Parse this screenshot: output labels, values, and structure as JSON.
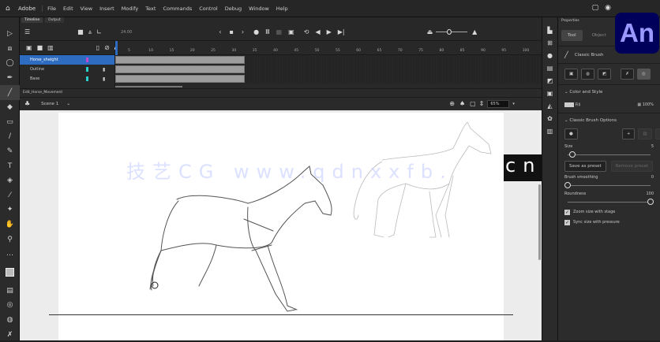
{
  "app": {
    "brand": "Adobe",
    "logo_text": "An",
    "menu": [
      "File",
      "Edit",
      "View",
      "Insert",
      "Modify",
      "Text",
      "Commands",
      "Control",
      "Debug",
      "Window",
      "Help"
    ]
  },
  "timeline": {
    "tabs": [
      "Timeline",
      "Output"
    ],
    "fps": "24.00",
    "frame_ticks": [
      "5",
      "10",
      "15",
      "20",
      "25",
      "30",
      "35",
      "40",
      "45",
      "50",
      "55",
      "60",
      "65",
      "70",
      "75",
      "80",
      "85",
      "90",
      "95",
      "100"
    ],
    "layers": [
      {
        "name": "Horse_sheight",
        "color": "#c04ad0",
        "selected": true
      },
      {
        "name": "Outline",
        "color": "#2ad0d0"
      },
      {
        "name": "Base",
        "color": "#2ad0d0"
      }
    ]
  },
  "editbar": {
    "doc_tab": "Edit_Horse_Movement",
    "scene": "Scene 1",
    "zoom": "65%"
  },
  "watermark": {
    "text": "技艺CG www.qdnxxfb.",
    "suffix": "cn"
  },
  "properties": {
    "title": "Properties",
    "tabs": [
      "Tool",
      "Object"
    ],
    "tool_name": "Classic Brush",
    "color_style": {
      "label": "Color and Style",
      "fill_label": "Fill",
      "opacity": "100%"
    },
    "brush_options": {
      "label": "Classic Brush Options",
      "size_label": "Size",
      "size": "5",
      "size_pct": 5,
      "save_preset": "Save as preset",
      "remove_preset": "Remove preset",
      "smoothing_label": "Brush smoothing",
      "smoothing": "0",
      "smoothing_pct": 0,
      "roundness_label": "Roundness",
      "roundness": "100",
      "roundness_pct": 100,
      "check1": "Zoom size with stage",
      "check2": "Sync size with pressure"
    }
  }
}
